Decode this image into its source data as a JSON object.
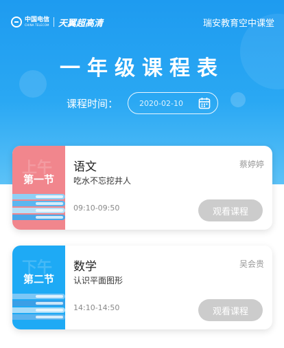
{
  "header": {
    "brand_cn": "中国电信",
    "brand_en": "CHINA TELECOM",
    "brand_product": "天翼超高清",
    "school": "瑞安教育空中课堂"
  },
  "title": "一年级课程表",
  "date": {
    "label": "课程时间：",
    "value": "2020-02-10",
    "icon": "calendar-icon"
  },
  "lessons": [
    {
      "period": "第一节",
      "watermark": "上午",
      "subject": "语文",
      "teacher": "蔡婷婷",
      "topic": "吃水不忘挖井人",
      "time": "09:10-09:50",
      "button": "观看课程",
      "color": "#f1868d"
    },
    {
      "period": "第二节",
      "watermark": "下午",
      "subject": "数学",
      "teacher": "吴会贵",
      "topic": "认识平面图形",
      "time": "14:10-14:50",
      "button": "观看课程",
      "color": "#1eaaf5"
    }
  ],
  "colors": {
    "header_blue": "#1e9bf0",
    "button_disabled": "#cccccc"
  }
}
